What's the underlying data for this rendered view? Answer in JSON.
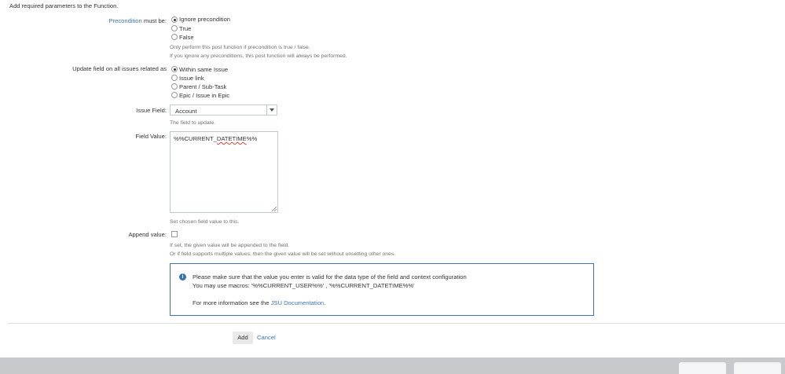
{
  "intro": "Add required parameters to the Function.",
  "precondition": {
    "label_link": "Precondition",
    "label_rest": "must be:",
    "options": [
      "Ignore precondition",
      "True",
      "False"
    ],
    "selected": "Ignore precondition",
    "help": [
      "Only perform this post function if precondition is true / false.",
      "If you ignore any preconditions, this post function will always be performed."
    ]
  },
  "update": {
    "label": "Update field on all issues related as",
    "options": [
      "Within same Issue",
      "Issue link",
      "Parent / Sub-Task",
      "Epic / Issue in Epic"
    ],
    "selected": "Within same Issue"
  },
  "issue_field": {
    "label": "Issue Field:",
    "value": "Account",
    "help": "The field to update."
  },
  "field_value": {
    "label": "Field Value:",
    "value_prefix": "%%CURRENT_",
    "value_misspelled": "DATETIME",
    "value_suffix": "%%",
    "help": "Set chosen field value to this."
  },
  "append": {
    "label": "Append value:",
    "checked": false,
    "help": [
      "If set, the given value will be appended to the field.",
      "Or if field supports multiple values, then the given value will be set without unsetting other ones."
    ]
  },
  "info": {
    "line1": "Please make sure that the value you enter is valid for the data type of the field and context configuration",
    "line2": "You may use macros: '%%CURRENT_USER%%' , '%%CURRENT_DATETIME%%'",
    "line3_prefix": "For more information see the ",
    "line3_link": "JSU Documentation",
    "line3_suffix": "."
  },
  "actions": {
    "add": "Add",
    "cancel": "Cancel"
  },
  "colors": {
    "link": "#3b73af",
    "footer": "#c7c9cc"
  }
}
